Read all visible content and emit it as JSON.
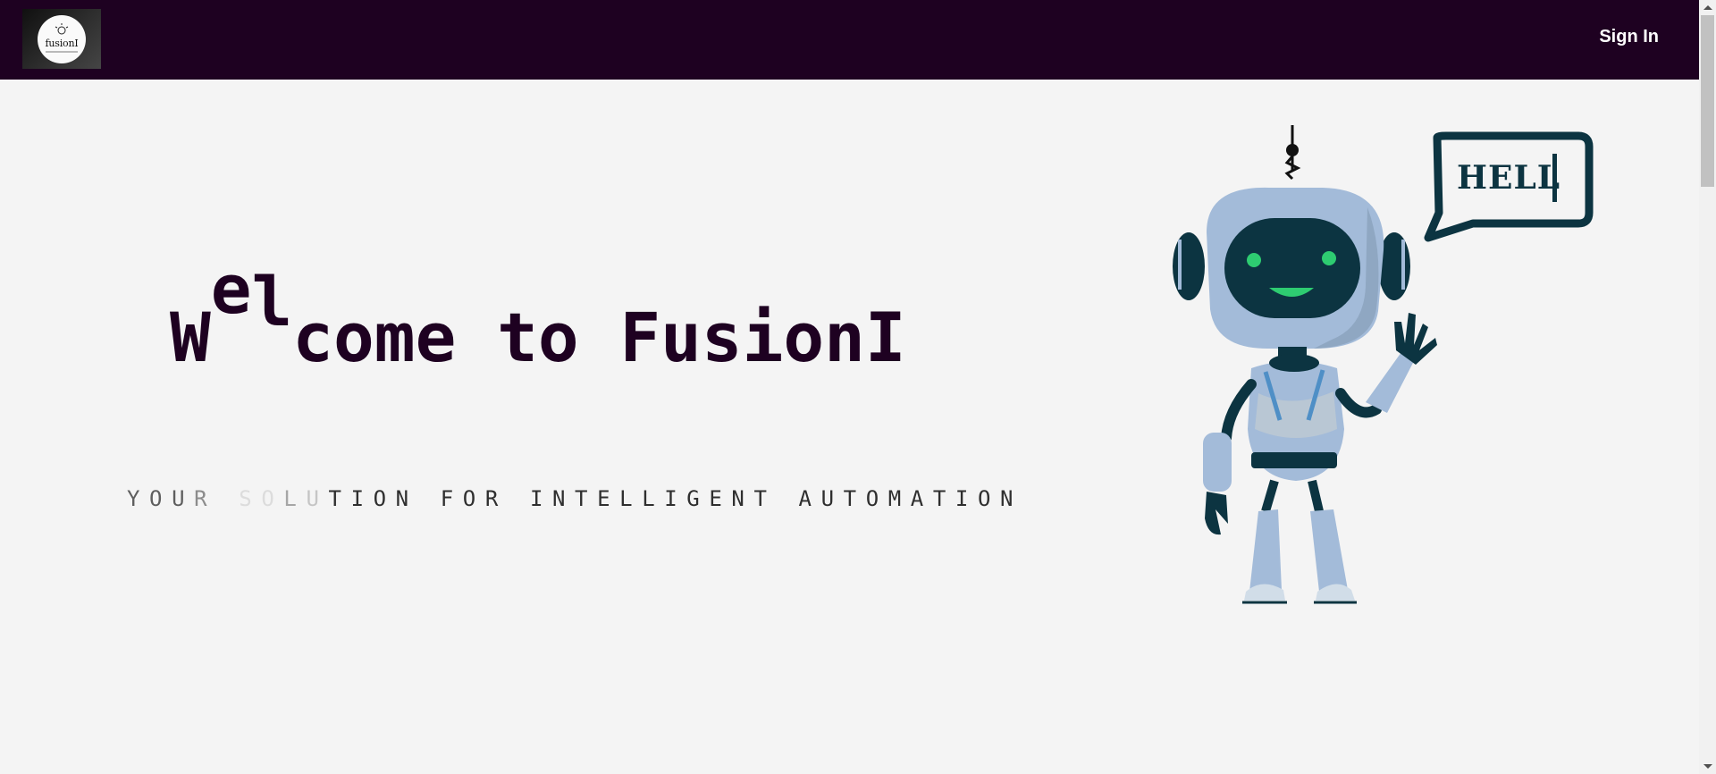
{
  "header": {
    "logo_text": "fusionI",
    "signin_label": "Sign In"
  },
  "hero": {
    "title_W": "W",
    "title_e": "e",
    "title_l": "l",
    "title_rest": "come to FusionI",
    "subtitle_1": "YOU",
    "subtitle_2": "R ",
    "subtitle_3": "S",
    "subtitle_4": "O",
    "subtitle_5": "L",
    "subtitle_6": "U",
    "subtitle_7": "TION FOR INTELLIGENT AUTOMATION"
  },
  "bubble": {
    "text": "HELL"
  },
  "colors": {
    "navbar": "#1e0121",
    "title": "#1e0121",
    "robot_body": "#a3bbd9",
    "robot_dark": "#0c3441",
    "robot_eyes": "#2ecc71"
  }
}
